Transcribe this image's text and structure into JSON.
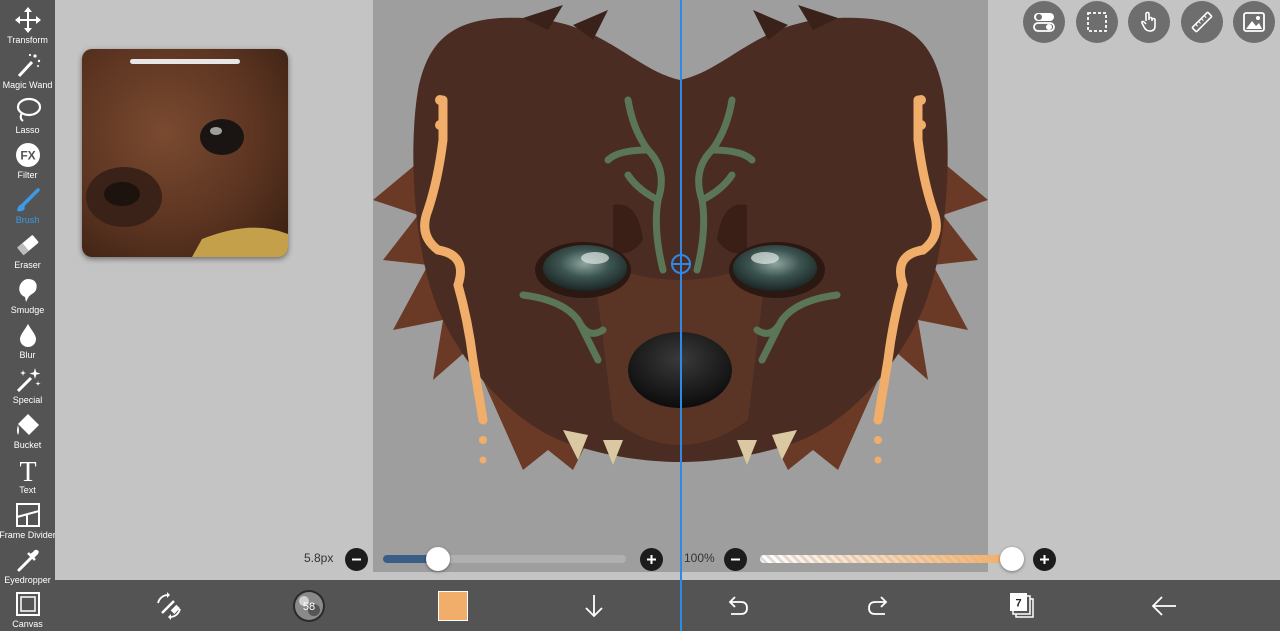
{
  "tools": [
    {
      "name": "transform",
      "label": "Transform",
      "icon": "move-arrows-icon"
    },
    {
      "name": "magic-wand",
      "label": "Magic Wand",
      "icon": "magic-wand-icon"
    },
    {
      "name": "lasso",
      "label": "Lasso",
      "icon": "lasso-icon"
    },
    {
      "name": "filter",
      "label": "Filter",
      "icon": "fx-icon"
    },
    {
      "name": "brush",
      "label": "Brush",
      "icon": "brush-icon",
      "active": true
    },
    {
      "name": "eraser",
      "label": "Eraser",
      "icon": "eraser-icon"
    },
    {
      "name": "smudge",
      "label": "Smudge",
      "icon": "smudge-icon"
    },
    {
      "name": "blur",
      "label": "Blur",
      "icon": "drop-icon"
    },
    {
      "name": "special",
      "label": "Special",
      "icon": "sparkle-wand-icon"
    },
    {
      "name": "bucket",
      "label": "Bucket",
      "icon": "bucket-icon"
    },
    {
      "name": "text",
      "label": "Text",
      "icon": "text-icon"
    },
    {
      "name": "frame-divider",
      "label": "Frame Divider",
      "icon": "frame-divider-icon"
    },
    {
      "name": "eyedropper",
      "label": "Eyedropper",
      "icon": "eyedropper-icon"
    },
    {
      "name": "canvas",
      "label": "Canvas",
      "icon": "canvas-icon"
    }
  ],
  "filter_glyph": "FX",
  "text_glyph": "T",
  "brush_size": {
    "label": "5.8px",
    "fraction": 0.08
  },
  "opacity": {
    "label": "100%",
    "fraction": 1.0
  },
  "brush_preview_label": "58",
  "layers_count": "7",
  "colors": {
    "accent": "#3c9be8",
    "current_color": "#f0ae6a",
    "toolbar_bg": "#545454",
    "workspace_bg": "#c4c4c4",
    "canvas_bg": "#9e9e9e"
  },
  "top_buttons": [
    "toggle-icon",
    "selection-icon",
    "touch-icon",
    "ruler-icon",
    "image-icon"
  ],
  "bottom_buttons": [
    "swap-tool-icon",
    "brush-preview",
    "current-color-swatch",
    "download-icon",
    "undo-icon",
    "redo-icon",
    "layers-icon",
    "back-icon"
  ]
}
